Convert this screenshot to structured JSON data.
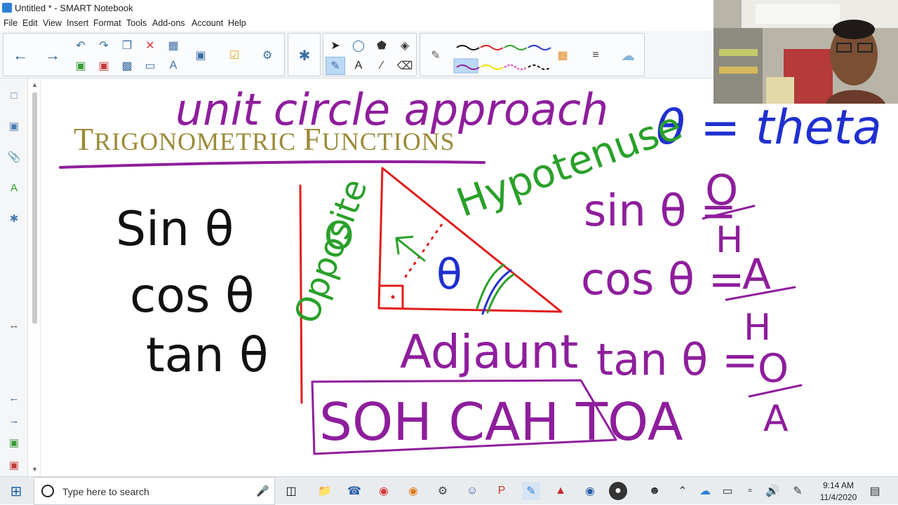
{
  "window": {
    "title": "Untitled * - SMART Notebook"
  },
  "menu": [
    "File",
    "Edit",
    "View",
    "Insert",
    "Format",
    "Tools",
    "Add-ons",
    "Account",
    "Help"
  ],
  "toolbar": {
    "icons": [
      "back-arrow-icon",
      "forward-arrow-icon",
      "undo-icon",
      "redo-icon",
      "paste-icon",
      "delete-icon",
      "table-icon",
      "add-page-icon",
      "delete-page-icon",
      "save-icon",
      "screen-shade-icon",
      "display-icon",
      "text-icon",
      "activity-icon",
      "response-icon",
      "widget-icon",
      "add-on-icon",
      "select-icon",
      "shapes-icon",
      "eraser-icon",
      "fill-icon",
      "pen-tool-icon",
      "text-tool-icon",
      "line-tool-icon",
      "pen-icon",
      "color-palette-icon",
      "line-style-icon",
      "cloud-icon"
    ]
  },
  "slide": {
    "heading_first": "T",
    "heading_rest1": "RIGONOMETRIC ",
    "heading_first2": "F",
    "heading_rest2": "UNCTIONS"
  },
  "ink": {
    "unit_circle": "unit circle approach",
    "theta_eq": "θ = theta",
    "hypotenuse": "Hypotenuse",
    "opposite": "Opposite",
    "adjacent": "Adjaunt",
    "sohcahtoa": "SOH CAH TOA",
    "left_list": [
      "Sin θ",
      "cos θ",
      "tan θ"
    ],
    "sin_eq": "sin θ =",
    "cos_eq": "cos θ =",
    "tan_eq": "tan θ =",
    "sin_frac": [
      "O",
      "H"
    ],
    "cos_frac": [
      "A",
      "H"
    ],
    "tan_frac": [
      "O",
      "A"
    ],
    "o_label": "O",
    "theta_symbol": "θ"
  },
  "colors": {
    "purple": "#8e1e9c",
    "blue": "#1f2fd0",
    "green": "#2aa02a",
    "red": "#e31b1b",
    "black": "#111111",
    "heading_gold": "#9b8a3a"
  },
  "taskbar": {
    "search_placeholder": "Type here to search",
    "time": "9:14 AM",
    "date": "11/4/2020"
  }
}
